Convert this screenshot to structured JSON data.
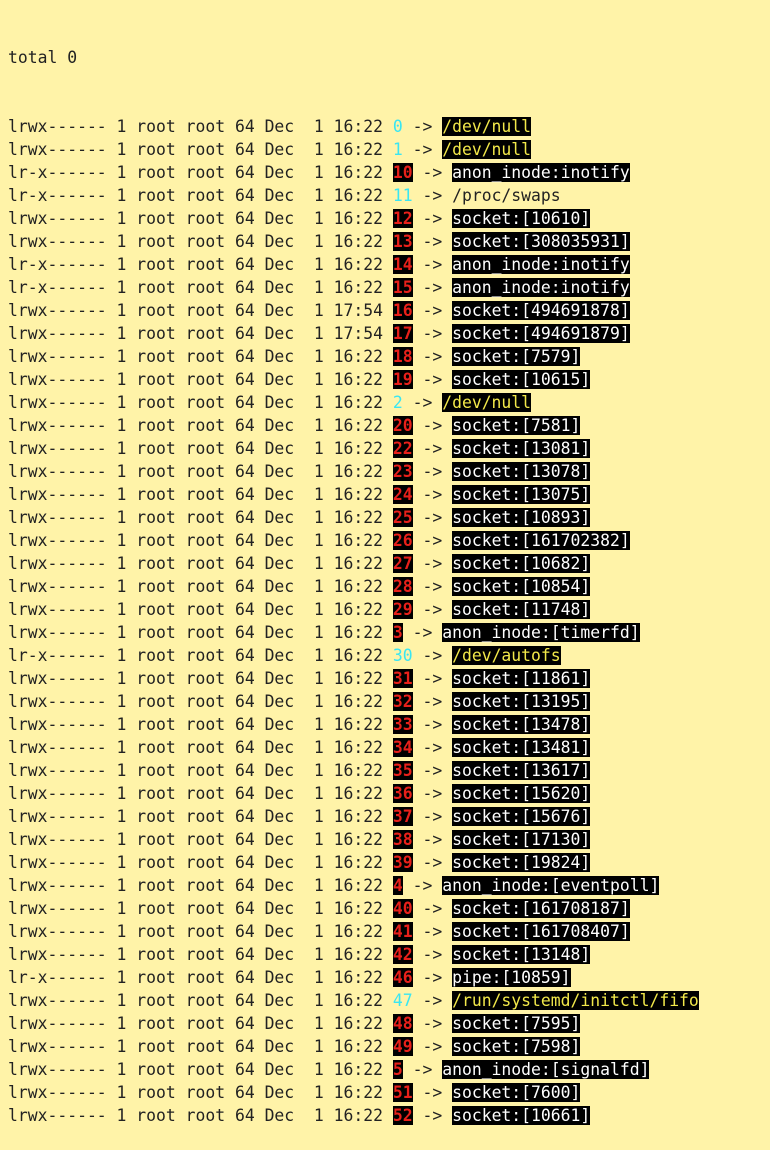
{
  "total_line": "total 0",
  "arrow": " -> ",
  "rows": [
    {
      "perm": "lrwx------",
      "links": "1",
      "owner": "root",
      "group": "root",
      "size": "64",
      "month": "Dec",
      "day": "1",
      "time": "16:22",
      "fd": "0",
      "fd_style": "cyan",
      "target": "/dev/null",
      "target_style": "yellow"
    },
    {
      "perm": "lrwx------",
      "links": "1",
      "owner": "root",
      "group": "root",
      "size": "64",
      "month": "Dec",
      "day": "1",
      "time": "16:22",
      "fd": "1",
      "fd_style": "cyan",
      "target": "/dev/null",
      "target_style": "yellow"
    },
    {
      "perm": "lr-x------",
      "links": "1",
      "owner": "root",
      "group": "root",
      "size": "64",
      "month": "Dec",
      "day": "1",
      "time": "16:22",
      "fd": "10",
      "fd_style": "red",
      "target": "anon_inode:inotify",
      "target_style": "white"
    },
    {
      "perm": "lr-x------",
      "links": "1",
      "owner": "root",
      "group": "root",
      "size": "64",
      "month": "Dec",
      "day": "1",
      "time": "16:22",
      "fd": "11",
      "fd_style": "cyan",
      "target": "/proc/swaps",
      "target_style": "plain"
    },
    {
      "perm": "lrwx------",
      "links": "1",
      "owner": "root",
      "group": "root",
      "size": "64",
      "month": "Dec",
      "day": "1",
      "time": "16:22",
      "fd": "12",
      "fd_style": "red",
      "target": "socket:[10610]",
      "target_style": "white"
    },
    {
      "perm": "lrwx------",
      "links": "1",
      "owner": "root",
      "group": "root",
      "size": "64",
      "month": "Dec",
      "day": "1",
      "time": "16:22",
      "fd": "13",
      "fd_style": "red",
      "target": "socket:[308035931]",
      "target_style": "white"
    },
    {
      "perm": "lr-x------",
      "links": "1",
      "owner": "root",
      "group": "root",
      "size": "64",
      "month": "Dec",
      "day": "1",
      "time": "16:22",
      "fd": "14",
      "fd_style": "red",
      "target": "anon_inode:inotify",
      "target_style": "white"
    },
    {
      "perm": "lr-x------",
      "links": "1",
      "owner": "root",
      "group": "root",
      "size": "64",
      "month": "Dec",
      "day": "1",
      "time": "16:22",
      "fd": "15",
      "fd_style": "red",
      "target": "anon_inode:inotify",
      "target_style": "white"
    },
    {
      "perm": "lrwx------",
      "links": "1",
      "owner": "root",
      "group": "root",
      "size": "64",
      "month": "Dec",
      "day": "1",
      "time": "17:54",
      "fd": "16",
      "fd_style": "red",
      "target": "socket:[494691878]",
      "target_style": "white"
    },
    {
      "perm": "lrwx------",
      "links": "1",
      "owner": "root",
      "group": "root",
      "size": "64",
      "month": "Dec",
      "day": "1",
      "time": "17:54",
      "fd": "17",
      "fd_style": "red",
      "target": "socket:[494691879]",
      "target_style": "white"
    },
    {
      "perm": "lrwx------",
      "links": "1",
      "owner": "root",
      "group": "root",
      "size": "64",
      "month": "Dec",
      "day": "1",
      "time": "16:22",
      "fd": "18",
      "fd_style": "red",
      "target": "socket:[7579]",
      "target_style": "white"
    },
    {
      "perm": "lrwx------",
      "links": "1",
      "owner": "root",
      "group": "root",
      "size": "64",
      "month": "Dec",
      "day": "1",
      "time": "16:22",
      "fd": "19",
      "fd_style": "red",
      "target": "socket:[10615]",
      "target_style": "white"
    },
    {
      "perm": "lrwx------",
      "links": "1",
      "owner": "root",
      "group": "root",
      "size": "64",
      "month": "Dec",
      "day": "1",
      "time": "16:22",
      "fd": "2",
      "fd_style": "cyan",
      "target": "/dev/null",
      "target_style": "yellow"
    },
    {
      "perm": "lrwx------",
      "links": "1",
      "owner": "root",
      "group": "root",
      "size": "64",
      "month": "Dec",
      "day": "1",
      "time": "16:22",
      "fd": "20",
      "fd_style": "red",
      "target": "socket:[7581]",
      "target_style": "white"
    },
    {
      "perm": "lrwx------",
      "links": "1",
      "owner": "root",
      "group": "root",
      "size": "64",
      "month": "Dec",
      "day": "1",
      "time": "16:22",
      "fd": "22",
      "fd_style": "red",
      "target": "socket:[13081]",
      "target_style": "white"
    },
    {
      "perm": "lrwx------",
      "links": "1",
      "owner": "root",
      "group": "root",
      "size": "64",
      "month": "Dec",
      "day": "1",
      "time": "16:22",
      "fd": "23",
      "fd_style": "red",
      "target": "socket:[13078]",
      "target_style": "white"
    },
    {
      "perm": "lrwx------",
      "links": "1",
      "owner": "root",
      "group": "root",
      "size": "64",
      "month": "Dec",
      "day": "1",
      "time": "16:22",
      "fd": "24",
      "fd_style": "red",
      "target": "socket:[13075]",
      "target_style": "white"
    },
    {
      "perm": "lrwx------",
      "links": "1",
      "owner": "root",
      "group": "root",
      "size": "64",
      "month": "Dec",
      "day": "1",
      "time": "16:22",
      "fd": "25",
      "fd_style": "red",
      "target": "socket:[10893]",
      "target_style": "white"
    },
    {
      "perm": "lrwx------",
      "links": "1",
      "owner": "root",
      "group": "root",
      "size": "64",
      "month": "Dec",
      "day": "1",
      "time": "16:22",
      "fd": "26",
      "fd_style": "red",
      "target": "socket:[161702382]",
      "target_style": "white"
    },
    {
      "perm": "lrwx------",
      "links": "1",
      "owner": "root",
      "group": "root",
      "size": "64",
      "month": "Dec",
      "day": "1",
      "time": "16:22",
      "fd": "27",
      "fd_style": "red",
      "target": "socket:[10682]",
      "target_style": "white"
    },
    {
      "perm": "lrwx------",
      "links": "1",
      "owner": "root",
      "group": "root",
      "size": "64",
      "month": "Dec",
      "day": "1",
      "time": "16:22",
      "fd": "28",
      "fd_style": "red",
      "target": "socket:[10854]",
      "target_style": "white"
    },
    {
      "perm": "lrwx------",
      "links": "1",
      "owner": "root",
      "group": "root",
      "size": "64",
      "month": "Dec",
      "day": "1",
      "time": "16:22",
      "fd": "29",
      "fd_style": "red",
      "target": "socket:[11748]",
      "target_style": "white"
    },
    {
      "perm": "lrwx------",
      "links": "1",
      "owner": "root",
      "group": "root",
      "size": "64",
      "month": "Dec",
      "day": "1",
      "time": "16:22",
      "fd": "3",
      "fd_style": "red",
      "target": "anon_inode:[timerfd]",
      "target_style": "white"
    },
    {
      "perm": "lr-x------",
      "links": "1",
      "owner": "root",
      "group": "root",
      "size": "64",
      "month": "Dec",
      "day": "1",
      "time": "16:22",
      "fd": "30",
      "fd_style": "cyan",
      "target": "/dev/autofs",
      "target_style": "yellow"
    },
    {
      "perm": "lrwx------",
      "links": "1",
      "owner": "root",
      "group": "root",
      "size": "64",
      "month": "Dec",
      "day": "1",
      "time": "16:22",
      "fd": "31",
      "fd_style": "red",
      "target": "socket:[11861]",
      "target_style": "white"
    },
    {
      "perm": "lrwx------",
      "links": "1",
      "owner": "root",
      "group": "root",
      "size": "64",
      "month": "Dec",
      "day": "1",
      "time": "16:22",
      "fd": "32",
      "fd_style": "red",
      "target": "socket:[13195]",
      "target_style": "white"
    },
    {
      "perm": "lrwx------",
      "links": "1",
      "owner": "root",
      "group": "root",
      "size": "64",
      "month": "Dec",
      "day": "1",
      "time": "16:22",
      "fd": "33",
      "fd_style": "red",
      "target": "socket:[13478]",
      "target_style": "white"
    },
    {
      "perm": "lrwx------",
      "links": "1",
      "owner": "root",
      "group": "root",
      "size": "64",
      "month": "Dec",
      "day": "1",
      "time": "16:22",
      "fd": "34",
      "fd_style": "red",
      "target": "socket:[13481]",
      "target_style": "white"
    },
    {
      "perm": "lrwx------",
      "links": "1",
      "owner": "root",
      "group": "root",
      "size": "64",
      "month": "Dec",
      "day": "1",
      "time": "16:22",
      "fd": "35",
      "fd_style": "red",
      "target": "socket:[13617]",
      "target_style": "white"
    },
    {
      "perm": "lrwx------",
      "links": "1",
      "owner": "root",
      "group": "root",
      "size": "64",
      "month": "Dec",
      "day": "1",
      "time": "16:22",
      "fd": "36",
      "fd_style": "red",
      "target": "socket:[15620]",
      "target_style": "white"
    },
    {
      "perm": "lrwx------",
      "links": "1",
      "owner": "root",
      "group": "root",
      "size": "64",
      "month": "Dec",
      "day": "1",
      "time": "16:22",
      "fd": "37",
      "fd_style": "red",
      "target": "socket:[15676]",
      "target_style": "white"
    },
    {
      "perm": "lrwx------",
      "links": "1",
      "owner": "root",
      "group": "root",
      "size": "64",
      "month": "Dec",
      "day": "1",
      "time": "16:22",
      "fd": "38",
      "fd_style": "red",
      "target": "socket:[17130]",
      "target_style": "white"
    },
    {
      "perm": "lrwx------",
      "links": "1",
      "owner": "root",
      "group": "root",
      "size": "64",
      "month": "Dec",
      "day": "1",
      "time": "16:22",
      "fd": "39",
      "fd_style": "red",
      "target": "socket:[19824]",
      "target_style": "white"
    },
    {
      "perm": "lrwx------",
      "links": "1",
      "owner": "root",
      "group": "root",
      "size": "64",
      "month": "Dec",
      "day": "1",
      "time": "16:22",
      "fd": "4",
      "fd_style": "red",
      "target": "anon_inode:[eventpoll]",
      "target_style": "white"
    },
    {
      "perm": "lrwx------",
      "links": "1",
      "owner": "root",
      "group": "root",
      "size": "64",
      "month": "Dec",
      "day": "1",
      "time": "16:22",
      "fd": "40",
      "fd_style": "red",
      "target": "socket:[161708187]",
      "target_style": "white"
    },
    {
      "perm": "lrwx------",
      "links": "1",
      "owner": "root",
      "group": "root",
      "size": "64",
      "month": "Dec",
      "day": "1",
      "time": "16:22",
      "fd": "41",
      "fd_style": "red",
      "target": "socket:[161708407]",
      "target_style": "white"
    },
    {
      "perm": "lrwx------",
      "links": "1",
      "owner": "root",
      "group": "root",
      "size": "64",
      "month": "Dec",
      "day": "1",
      "time": "16:22",
      "fd": "42",
      "fd_style": "red",
      "target": "socket:[13148]",
      "target_style": "white"
    },
    {
      "perm": "lr-x------",
      "links": "1",
      "owner": "root",
      "group": "root",
      "size": "64",
      "month": "Dec",
      "day": "1",
      "time": "16:22",
      "fd": "46",
      "fd_style": "red",
      "target": "pipe:[10859]",
      "target_style": "white"
    },
    {
      "perm": "lrwx------",
      "links": "1",
      "owner": "root",
      "group": "root",
      "size": "64",
      "month": "Dec",
      "day": "1",
      "time": "16:22",
      "fd": "47",
      "fd_style": "cyan",
      "target": "/run/systemd/initctl/fifo",
      "target_style": "yellow"
    },
    {
      "perm": "lrwx------",
      "links": "1",
      "owner": "root",
      "group": "root",
      "size": "64",
      "month": "Dec",
      "day": "1",
      "time": "16:22",
      "fd": "48",
      "fd_style": "red",
      "target": "socket:[7595]",
      "target_style": "white"
    },
    {
      "perm": "lrwx------",
      "links": "1",
      "owner": "root",
      "group": "root",
      "size": "64",
      "month": "Dec",
      "day": "1",
      "time": "16:22",
      "fd": "49",
      "fd_style": "red",
      "target": "socket:[7598]",
      "target_style": "white"
    },
    {
      "perm": "lrwx------",
      "links": "1",
      "owner": "root",
      "group": "root",
      "size": "64",
      "month": "Dec",
      "day": "1",
      "time": "16:22",
      "fd": "5",
      "fd_style": "red",
      "target": "anon_inode:[signalfd]",
      "target_style": "white"
    },
    {
      "perm": "lrwx------",
      "links": "1",
      "owner": "root",
      "group": "root",
      "size": "64",
      "month": "Dec",
      "day": "1",
      "time": "16:22",
      "fd": "51",
      "fd_style": "red",
      "target": "socket:[7600]",
      "target_style": "white"
    },
    {
      "perm": "lrwx------",
      "links": "1",
      "owner": "root",
      "group": "root",
      "size": "64",
      "month": "Dec",
      "day": "1",
      "time": "16:22",
      "fd": "52",
      "fd_style": "red",
      "target": "socket:[10661]",
      "target_style": "white"
    }
  ],
  "colors": {
    "background": "#fff3a8",
    "text": "#222222",
    "fd_red": "#e8201a",
    "fd_cyan": "#39e6f2",
    "target_highlight_bg": "#000000",
    "target_white": "#ffffff",
    "target_yellow": "#f2e84a"
  }
}
